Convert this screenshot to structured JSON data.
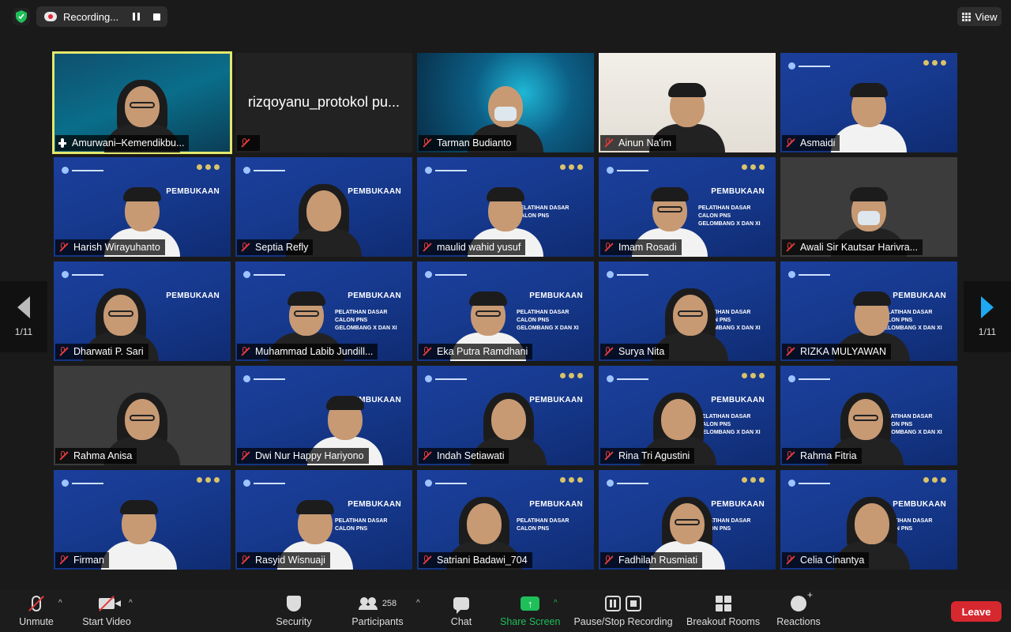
{
  "topbar": {
    "recording_label": "Recording...",
    "view_label": "View"
  },
  "pagination": {
    "left_indicator": "1/11",
    "right_indicator": "1/11"
  },
  "participants": [
    {
      "name": "Amurwani–Kemendikbu...",
      "hand_raised": true
    },
    {
      "name": "rizqoyanu_protokol pu...",
      "display_name": "rizqoyanu_protokol pu..."
    },
    {
      "name": "Tarman Budianto"
    },
    {
      "name": "Ainun Na'im"
    },
    {
      "name": "Asmaidi"
    },
    {
      "name": "Harish Wirayuhanto"
    },
    {
      "name": "Septia Refly"
    },
    {
      "name": "maulid wahid yusuf"
    },
    {
      "name": "Imam Rosadi"
    },
    {
      "name": "Awali Sir Kautsar Harivra..."
    },
    {
      "name": "Dharwati P. Sari"
    },
    {
      "name": "Muhammad Labib Jundill..."
    },
    {
      "name": "Eka Putra Ramdhani"
    },
    {
      "name": "Surya Nita"
    },
    {
      "name": "RIZKA MULYAWAN"
    },
    {
      "name": "Rahma Anisa"
    },
    {
      "name": "Dwi Nur Happy Hariyono"
    },
    {
      "name": "Indah Setiawati"
    },
    {
      "name": "Rina Tri Agustini"
    },
    {
      "name": "Rahma Fitria"
    },
    {
      "name": "Firman"
    },
    {
      "name": "Rasyid Wisnuaji"
    },
    {
      "name": "Satriani Badawi_704"
    },
    {
      "name": "Fadhilah Rusmiati"
    },
    {
      "name": "Celia Cinantya"
    }
  ],
  "slide": {
    "title": "PEMBUKAAN",
    "line1": "PELATIHAN DASAR",
    "line2": "CALON PNS",
    "line3": "GELOMBANG X DAN XI"
  },
  "toolbar": {
    "unmute": "Unmute",
    "start_video": "Start Video",
    "security": "Security",
    "participants": "Participants",
    "participants_count": "258",
    "chat": "Chat",
    "share_screen": "Share Screen",
    "pause_stop_recording": "Pause/Stop Recording",
    "breakout_rooms": "Breakout Rooms",
    "reactions": "Reactions",
    "leave": "Leave"
  },
  "colors": {
    "active_speaker_border": "#e3e86b",
    "share_green": "#1fbf5a",
    "leave_red": "#d6282f",
    "muted_red": "#e23b3b",
    "next_arrow": "#1fa8f2"
  }
}
